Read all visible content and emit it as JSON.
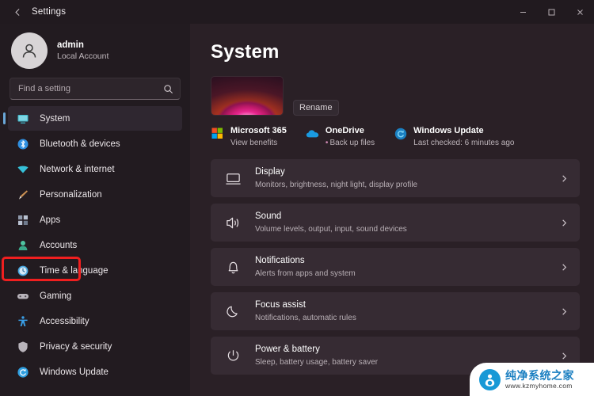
{
  "window": {
    "title": "Settings",
    "back_icon": "back-arrow-icon",
    "controls": [
      {
        "name": "minimize",
        "icon": "minimize-icon"
      },
      {
        "name": "maximize",
        "icon": "maximize-icon"
      },
      {
        "name": "close",
        "icon": "close-icon"
      }
    ]
  },
  "sidebar": {
    "account": {
      "avatar_icon": "user-avatar-icon",
      "name": "admin",
      "subtitle": "Local Account"
    },
    "search": {
      "placeholder": "Find a setting",
      "value": "",
      "icon": "search-icon"
    },
    "items": [
      {
        "label": "System",
        "icon": "monitor-icon",
        "color": "#3fb6c9",
        "selected": true
      },
      {
        "label": "Bluetooth & devices",
        "icon": "bluetooth-icon",
        "color": "#2f8fe0",
        "selected": false
      },
      {
        "label": "Network & internet",
        "icon": "wifi-icon",
        "color": "#36c0d8",
        "selected": false
      },
      {
        "label": "Personalization",
        "icon": "paintbrush-icon",
        "color": "#d8b070",
        "selected": false
      },
      {
        "label": "Apps",
        "icon": "apps-icon",
        "color": "#9aa7bb",
        "selected": false
      },
      {
        "label": "Accounts",
        "icon": "person-icon",
        "color": "#4fc3a1",
        "selected": false
      },
      {
        "label": "Time & language",
        "icon": "clock-icon",
        "color": "#4aa8e0",
        "selected": false
      },
      {
        "label": "Gaming",
        "icon": "gamepad-icon",
        "color": "#b9b4bb",
        "selected": false
      },
      {
        "label": "Accessibility",
        "icon": "accessibility-icon",
        "color": "#3a9fe8",
        "selected": false
      },
      {
        "label": "Privacy & security",
        "icon": "shield-icon",
        "color": "#b9b4bb",
        "selected": false
      },
      {
        "label": "Windows Update",
        "icon": "update-icon",
        "color": "#2f9fe0",
        "selected": false
      }
    ],
    "highlight": {
      "target": "Accounts",
      "color": "#f01f1f"
    }
  },
  "main": {
    "title": "System",
    "device": {
      "thumbnail_icon": "device-wallpaper-thumbnail",
      "rename_label": "Rename"
    },
    "status_items": [
      {
        "title": "Microsoft 365",
        "subtitle": "View benefits",
        "icon": "microsoft-logo-icon",
        "bullet": false
      },
      {
        "title": "OneDrive",
        "subtitle": "Back up files",
        "icon": "onedrive-cloud-icon",
        "bullet": true
      },
      {
        "title": "Windows Update",
        "subtitle": "Last checked: 6 minutes ago",
        "icon": "update-icon",
        "bullet": false
      }
    ],
    "rows": [
      {
        "title": "Display",
        "subtitle": "Monitors, brightness, night light, display profile",
        "icon": "display-icon",
        "chevron": "chevron-right-icon"
      },
      {
        "title": "Sound",
        "subtitle": "Volume levels, output, input, sound devices",
        "icon": "speaker-icon",
        "chevron": "chevron-right-icon"
      },
      {
        "title": "Notifications",
        "subtitle": "Alerts from apps and system",
        "icon": "bell-icon",
        "chevron": "chevron-right-icon"
      },
      {
        "title": "Focus assist",
        "subtitle": "Notifications, automatic rules",
        "icon": "moon-icon",
        "chevron": "chevron-right-icon"
      },
      {
        "title": "Power & battery",
        "subtitle": "Sleep, battery usage, battery saver",
        "icon": "power-icon",
        "chevron": "chevron-right-icon"
      }
    ]
  },
  "watermark": {
    "icon": "watermark-logo-icon",
    "name": "纯净系统之家",
    "url": "www.kzmyhome.com"
  }
}
